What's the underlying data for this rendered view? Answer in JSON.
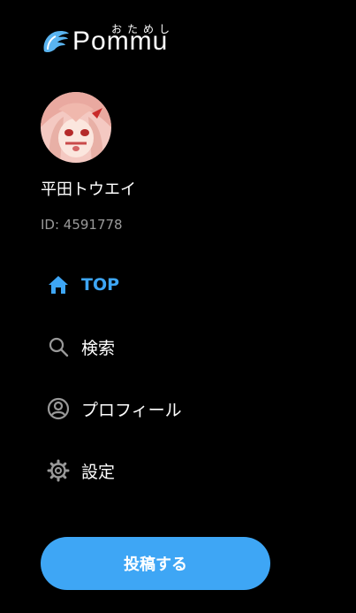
{
  "brand": {
    "name": "Pommu",
    "kana": "おためし",
    "accent_color": "#3ea6f5"
  },
  "user": {
    "name": "平田トウエイ",
    "id_text": "ID: 4591778"
  },
  "nav": {
    "items": [
      {
        "label": "TOP",
        "icon": "home-icon",
        "active": true
      },
      {
        "label": "検索",
        "icon": "search-icon",
        "active": false
      },
      {
        "label": "プロフィール",
        "icon": "profile-icon",
        "active": false
      },
      {
        "label": "設定",
        "icon": "gear-icon",
        "active": false
      }
    ]
  },
  "actions": {
    "post_label": "投稿する"
  }
}
